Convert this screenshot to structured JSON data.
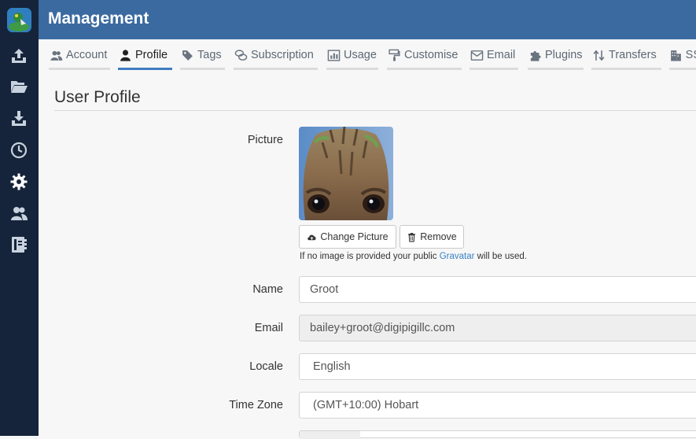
{
  "header": {
    "title": "Management"
  },
  "tabs": [
    {
      "label": "Account",
      "icon": "users-icon"
    },
    {
      "label": "Profile",
      "icon": "user-icon"
    },
    {
      "label": "Tags",
      "icon": "tag-icon"
    },
    {
      "label": "Subscription",
      "icon": "coins-icon"
    },
    {
      "label": "Usage",
      "icon": "bar-chart-icon"
    },
    {
      "label": "Customise",
      "icon": "paint-roller-icon"
    },
    {
      "label": "Email",
      "icon": "envelope-icon"
    },
    {
      "label": "Plugins",
      "icon": "puzzle-icon"
    },
    {
      "label": "Transfers",
      "icon": "arrows-updown-icon"
    },
    {
      "label": "SS",
      "icon": "building-icon"
    }
  ],
  "active_tab": "Profile",
  "page": {
    "title": "User Profile"
  },
  "picture": {
    "label": "Picture",
    "change_label": "Change Picture",
    "remove_label": "Remove",
    "help_prefix": "If no image is provided your public ",
    "help_link": "Gravatar",
    "help_suffix": " will be used."
  },
  "fields": {
    "name": {
      "label": "Name",
      "value": "Groot"
    },
    "email": {
      "label": "Email",
      "value": "bailey+groot@digipigillc.com"
    },
    "locale": {
      "label": "Locale",
      "value": "English"
    },
    "timezone": {
      "label": "Time Zone",
      "value": "(GMT+10:00) Hobart"
    }
  },
  "colors": {
    "sidebar": "#15243a",
    "header": "#3a6aa0",
    "accent": "#3f7cc0",
    "link": "#3a82c4"
  }
}
